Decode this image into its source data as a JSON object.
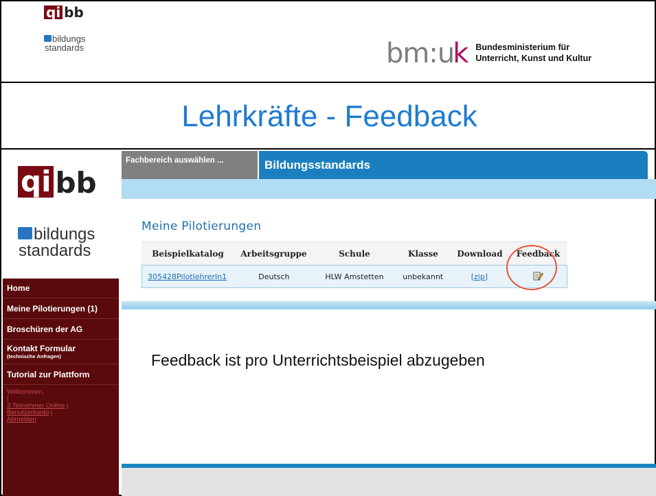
{
  "header": {
    "qibb_small": {
      "qi": "qi",
      "bb": "bb",
      "line1": "bildungs",
      "line2": "standards"
    },
    "bmuk": {
      "mark": "bm:uk",
      "line1": "Bundesministerium für",
      "line2": "Unterricht, Kunst und Kultur"
    },
    "title": "Lehrkräfte - Feedback"
  },
  "sidebar": {
    "logo": {
      "qi": "qi",
      "bb": "bb",
      "line1": "bildungs",
      "line2": "standards"
    },
    "items": [
      {
        "label": "Home"
      },
      {
        "label": "Meine Pilotierungen (1)"
      },
      {
        "label": "Broschüren der AG"
      },
      {
        "label": "Kontakt Formular",
        "sub": "(technische Anfragen)"
      },
      {
        "label": "Tutorial zur Plattform"
      }
    ],
    "user": {
      "welcome": "Willkommen,",
      "sep": "|",
      "online": "3 Teilnehmer Online",
      "account": "Benutzerkonto",
      "logout": "Abmelden"
    }
  },
  "tabs": {
    "select": "Fachbereich auswählen ...",
    "active": "Bildungsstandards"
  },
  "main": {
    "section_title": "Meine Pilotierungen",
    "columns": [
      "Beispielkatalog",
      "Arbeitsgruppe",
      "Schule",
      "Klasse",
      "Download",
      "Feedback"
    ],
    "rows": [
      {
        "katalog": "305428PilotlehrerIn1",
        "gruppe": "Deutsch",
        "schule": "HLW Amstetten",
        "klasse": "unbekannt",
        "download": "[zip]",
        "feedback_icon": "edit-note-icon"
      }
    ],
    "message": "Feedback ist pro Unterrichtsbeispiel abzugeben"
  },
  "colors": {
    "brand_red": "#5a0a0c",
    "brand_blue": "#1b7fbf",
    "title_blue": "#1f7bd0",
    "highlight_circle": "#e8553a"
  }
}
